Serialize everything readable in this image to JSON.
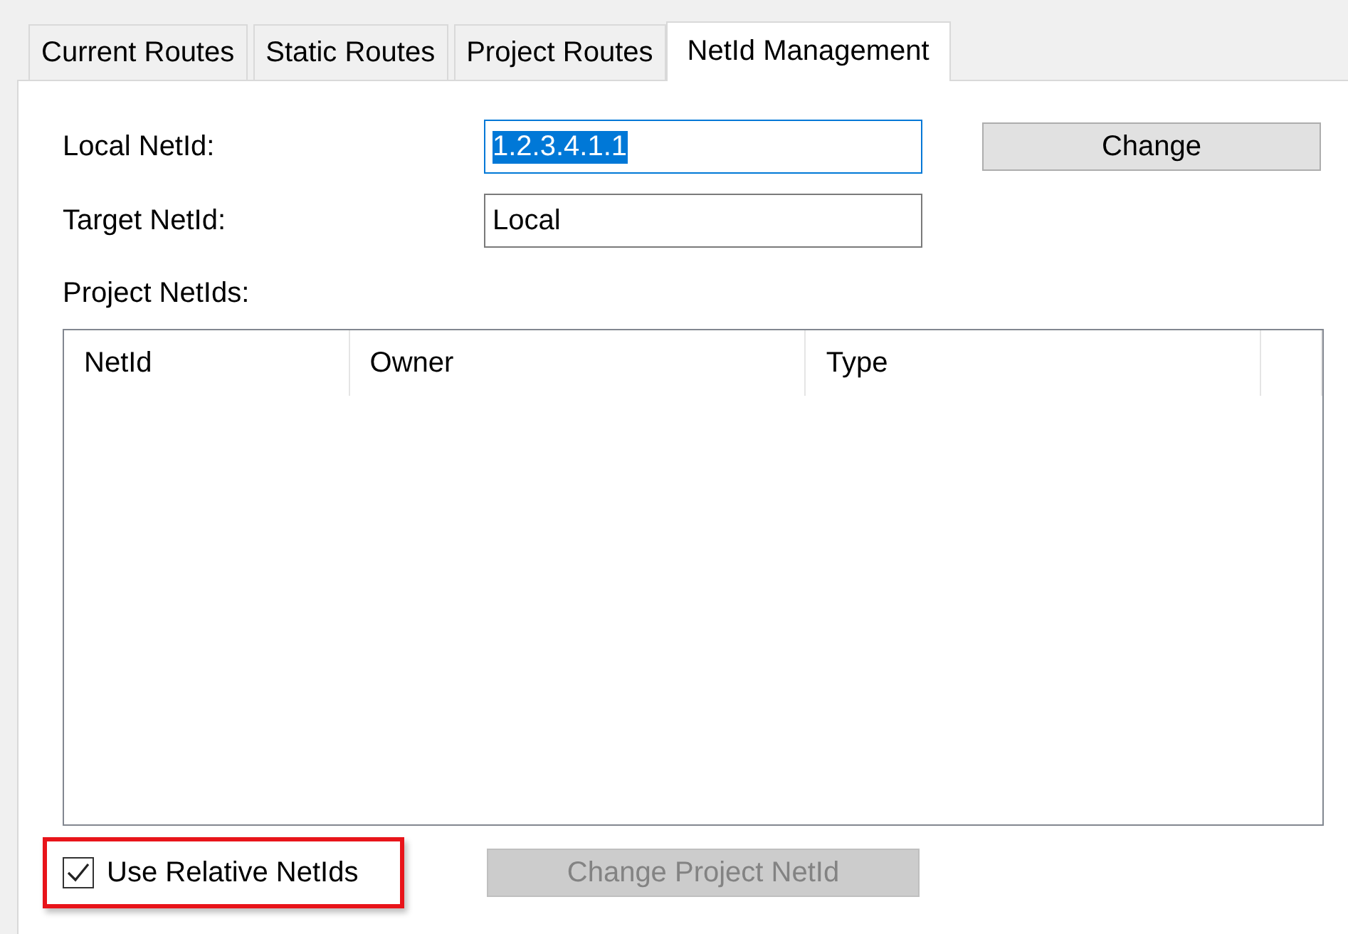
{
  "tabs": [
    {
      "label": "Current Routes",
      "selected": false
    },
    {
      "label": "Static Routes",
      "selected": false
    },
    {
      "label": "Project Routes",
      "selected": false
    },
    {
      "label": "NetId Management",
      "selected": true
    }
  ],
  "local_netid": {
    "label": "Local NetId:",
    "value": "1.2.3.4.1.1",
    "focused": true
  },
  "change_button": {
    "label": "Change",
    "disabled": false
  },
  "target_netid": {
    "label": "Target NetId:",
    "value": "Local",
    "focused": false
  },
  "project_netids": {
    "label": "Project NetIds:",
    "columns": [
      "NetId",
      "Owner",
      "Type"
    ]
  },
  "use_relative_netids": {
    "label": "Use Relative NetIds",
    "checked": true,
    "highlighted": true
  },
  "change_project_netid_button": {
    "label": "Change Project NetId",
    "disabled": true
  }
}
